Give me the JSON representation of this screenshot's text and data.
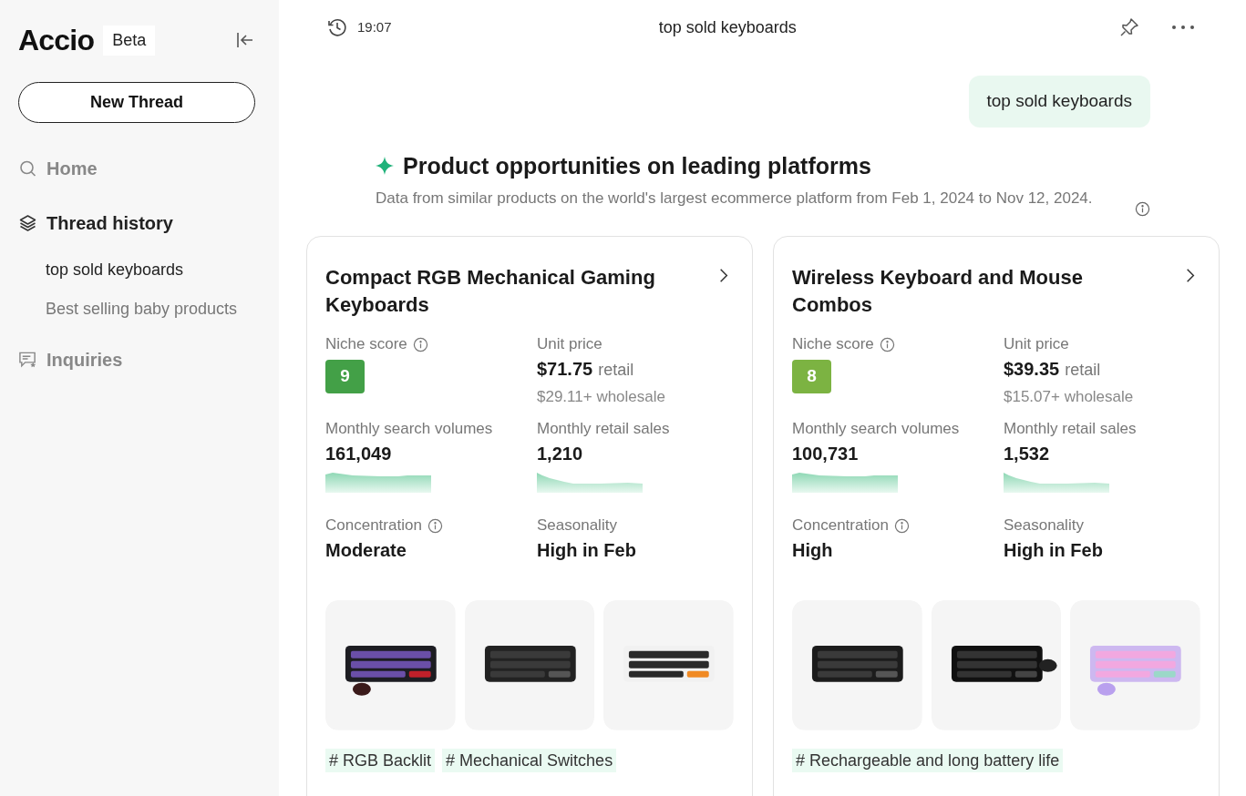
{
  "sidebar": {
    "logo": "Accio",
    "badge": "Beta",
    "new_thread_button": "New Thread",
    "nav": [
      {
        "kind": "search",
        "label": "Home",
        "selected": false
      },
      {
        "kind": "layers",
        "label": "Thread history",
        "selected": true,
        "children": [
          {
            "label": "top sold keyboards",
            "selected": true
          },
          {
            "label": "Best selling baby products",
            "selected": false
          }
        ]
      },
      {
        "kind": "inquiries",
        "label": "Inquiries",
        "selected": false
      }
    ]
  },
  "header": {
    "time": "19:07",
    "title": "top sold keyboards"
  },
  "user_message": "top sold keyboards",
  "section": {
    "title": "Product opportunities on leading platforms",
    "subtitle": "Data from similar products on the world's largest ecommerce platform from Feb 1, 2024 to Nov 12, 2024."
  },
  "products": [
    {
      "title": "Compact RGB Mechanical Gaming Keyboards",
      "niche_score_label": "Niche score",
      "niche_score": "9",
      "color": "#43a047",
      "unit_price_label": "Unit price",
      "retail_price": "$71.75",
      "retail_label": "retail",
      "wholesale": "$29.11+ wholesale",
      "search_label": "Monthly search volumes",
      "search_value": "161,049",
      "sales_label": "Monthly retail sales",
      "sales_value": "1,210",
      "concentration_label": "Concentration",
      "concentration": "Moderate",
      "seasonality_label": "Seasonality",
      "seasonality": "High in Feb",
      "images": [
        {
          "kind": "picture"
        },
        {
          "kind": "picture"
        },
        {
          "kind": "picture"
        }
      ],
      "tags": [
        "# RGB Backlit",
        "# Mechanical Switches"
      ]
    },
    {
      "title": "Wireless Keyboard and Mouse Combos",
      "niche_score_label": "Niche score",
      "niche_score": "8",
      "color": "#7cb342",
      "unit_price_label": "Unit price",
      "retail_price": "$39.35",
      "retail_label": "retail",
      "wholesale": "$15.07+ wholesale",
      "search_label": "Monthly search volumes",
      "search_value": "100,731",
      "sales_label": "Monthly retail sales",
      "sales_value": "1,532",
      "concentration_label": "Concentration",
      "concentration": "High",
      "seasonality_label": "Seasonality",
      "seasonality": "High in Feb",
      "images": [
        {
          "kind": "picture"
        },
        {
          "kind": "picture"
        },
        {
          "kind": "picture"
        }
      ],
      "tags": [
        "# Rechargeable and long battery life"
      ]
    }
  ]
}
